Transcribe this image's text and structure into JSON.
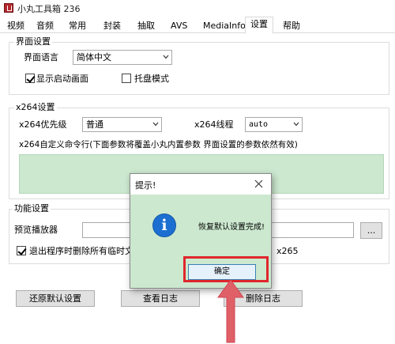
{
  "window": {
    "title": "小丸工具箱 236"
  },
  "tabs": [
    "视频",
    "音频",
    "常用",
    "封装",
    "抽取",
    "AVS",
    "MediaInfo",
    "设置",
    "帮助"
  ],
  "active_tab": "设置",
  "ui_settings": {
    "group_title": "界面设置",
    "language_label": "界面语言",
    "language_value": "简体中文",
    "show_splash_label": "显示启动画面",
    "show_splash_checked": true,
    "tray_mode_label": "托盘模式",
    "tray_mode_checked": false
  },
  "x264_settings": {
    "group_title": "x264设置",
    "priority_label": "x264优先级",
    "priority_value": "普通",
    "threads_label": "x264线程",
    "threads_value": "auto",
    "custom_cmd_label": "x264自定义命令行(下面参数将覆盖小丸内置参数 界面设置的参数依然有效)"
  },
  "func_settings": {
    "group_title": "功能设置",
    "preview_player_label": "预览播放器",
    "browse_label": "...",
    "delete_temp_label": "退出程序时删除所有临时文件",
    "delete_temp_checked": true,
    "x265_partial": "x265"
  },
  "bottom_buttons": {
    "restore_defaults": "还原默认设置",
    "view_log": "查看日志",
    "delete_log": "删除日志"
  },
  "dialog": {
    "title": "提示!",
    "message": "恢复默认设置完成!",
    "ok_label": "确定",
    "icon": "info-icon"
  },
  "colors": {
    "dialog_bg": "#cce8cf",
    "highlight": "#e0262c",
    "info_icon": "#1c6fd1"
  }
}
